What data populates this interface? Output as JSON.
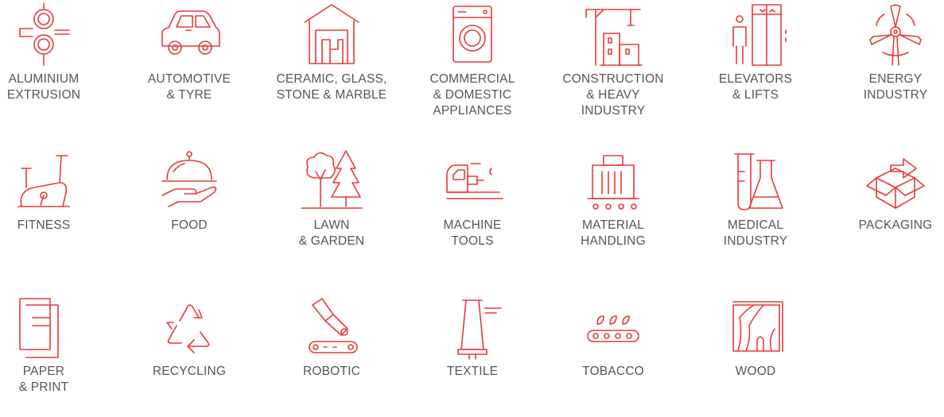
{
  "colors": {
    "accent": "#e63b3b",
    "label": "#555555",
    "background": "#ffffff"
  },
  "industries": [
    {
      "id": "aluminium-extrusion",
      "icon": "extrusion-rollers-icon",
      "lines": [
        "ALUMINIUM",
        "EXTRUSION"
      ]
    },
    {
      "id": "automotive-tyre",
      "icon": "car-icon",
      "lines": [
        "AUTOMOTIVE",
        "& TYRE"
      ]
    },
    {
      "id": "ceramic-glass-stone-marble",
      "icon": "warehouse-icon",
      "lines": [
        "CERAMIC, GLASS,",
        "STONE & MARBLE"
      ]
    },
    {
      "id": "commercial-domestic-appliances",
      "icon": "washing-machine-icon",
      "lines": [
        "COMMERCIAL",
        "& DOMESTIC",
        "APPLIANCES"
      ]
    },
    {
      "id": "construction-heavy-industry",
      "icon": "crane-building-icon",
      "lines": [
        "CONSTRUCTION",
        "& HEAVY",
        "INDUSTRY"
      ]
    },
    {
      "id": "elevators-lifts",
      "icon": "elevator-icon",
      "lines": [
        "ELEVATORS",
        "& LIFTS"
      ]
    },
    {
      "id": "energy-industry",
      "icon": "wind-turbine-icon",
      "lines": [
        "ENERGY",
        "INDUSTRY"
      ]
    },
    {
      "id": "fitness",
      "icon": "exercise-bike-icon",
      "lines": [
        "FITNESS"
      ]
    },
    {
      "id": "food",
      "icon": "cloche-hand-icon",
      "lines": [
        "FOOD"
      ]
    },
    {
      "id": "lawn-garden",
      "icon": "trees-icon",
      "lines": [
        "LAWN",
        "& GARDEN"
      ]
    },
    {
      "id": "machine-tools",
      "icon": "machine-tool-icon",
      "lines": [
        "MACHINE",
        "TOOLS"
      ]
    },
    {
      "id": "material-handling",
      "icon": "cargo-trolley-icon",
      "lines": [
        "MATERIAL",
        "HANDLING"
      ]
    },
    {
      "id": "medical-industry",
      "icon": "lab-glassware-icon",
      "lines": [
        "MEDICAL",
        "INDUSTRY"
      ]
    },
    {
      "id": "packaging",
      "icon": "open-box-icon",
      "lines": [
        "PACKAGING"
      ]
    },
    {
      "id": "paper-print",
      "icon": "paper-sheets-icon",
      "lines": [
        "PAPER",
        "& PRINT"
      ]
    },
    {
      "id": "recycling",
      "icon": "recycle-icon",
      "lines": [
        "RECYCLING"
      ]
    },
    {
      "id": "robotic",
      "icon": "robot-arm-icon",
      "lines": [
        "ROBOTIC"
      ]
    },
    {
      "id": "textile",
      "icon": "thread-spool-icon",
      "lines": [
        "TEXTILE"
      ]
    },
    {
      "id": "tobacco",
      "icon": "leaf-conveyor-icon",
      "lines": [
        "TOBACCO"
      ]
    },
    {
      "id": "wood",
      "icon": "wood-grain-icon",
      "lines": [
        "WOOD"
      ]
    }
  ]
}
